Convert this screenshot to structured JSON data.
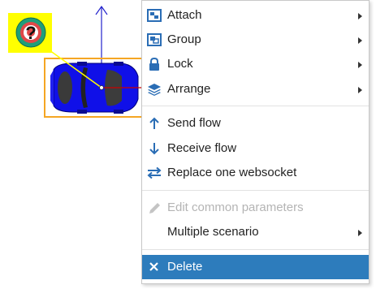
{
  "menu": {
    "items": [
      {
        "label": "Attach",
        "icon": "attach-icon",
        "submenu": true
      },
      {
        "label": "Group",
        "icon": "group-icon",
        "submenu": true
      },
      {
        "label": "Lock",
        "icon": "lock-icon",
        "submenu": true
      },
      {
        "label": "Arrange",
        "icon": "layers-icon",
        "submenu": true
      },
      {
        "label": "Send flow",
        "icon": "arrow-up-icon",
        "submenu": false
      },
      {
        "label": "Receive flow",
        "icon": "arrow-down-icon",
        "submenu": false
      },
      {
        "label": "Replace one websocket",
        "icon": "swap-icon",
        "submenu": false
      },
      {
        "label": "Edit common parameters",
        "icon": "pencil-icon",
        "disabled": true
      },
      {
        "label": "Multiple scenario",
        "submenu": true
      },
      {
        "label": "Delete",
        "icon": "close-icon",
        "highlighted": true
      }
    ]
  },
  "colors": {
    "accent": "#2d7cbc",
    "icon_blue": "#2a6db5",
    "vehicle_blue": "#1010e8",
    "selection_orange": "#f5a623",
    "badge_yellow": "#ffff00",
    "axis_blue": "#2222cc",
    "axis_red": "#cc0000",
    "disabled_text": "#b4b4b4"
  }
}
